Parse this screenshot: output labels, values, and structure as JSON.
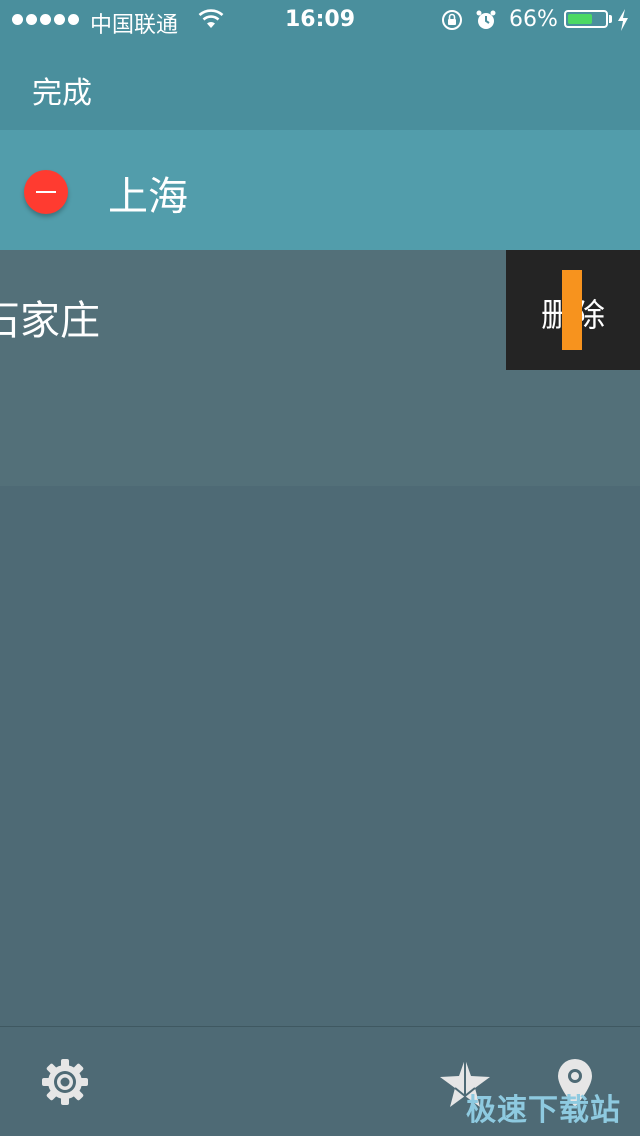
{
  "status_bar": {
    "carrier": "中国联通",
    "time": "16:09",
    "battery_percent": "66%",
    "battery_level": 0.66,
    "icons": [
      "signal-dots",
      "wifi-icon",
      "rotation-lock-icon",
      "alarm-icon",
      "battery-icon",
      "charging-bolt-icon"
    ]
  },
  "nav": {
    "done_label": "完成"
  },
  "cities": [
    {
      "name": "上海",
      "edit_control": "minus-circle-icon",
      "edit_color": "#ff3b30"
    },
    {
      "name": "石家庄",
      "swipe_action": "删除"
    }
  ],
  "tab_bar": {
    "icons": [
      "gear-icon",
      "star-icon",
      "location-pin-icon"
    ]
  },
  "watermark": "极速下载站",
  "colors": {
    "header": "#4a8f9d",
    "row_selected": "#529dab",
    "row": "#537079",
    "background": "#4e6a75",
    "delete_bg": "#242424",
    "minus": "#ff3b30",
    "battery": "#4cd964",
    "touch_marker": "#f7931e"
  }
}
